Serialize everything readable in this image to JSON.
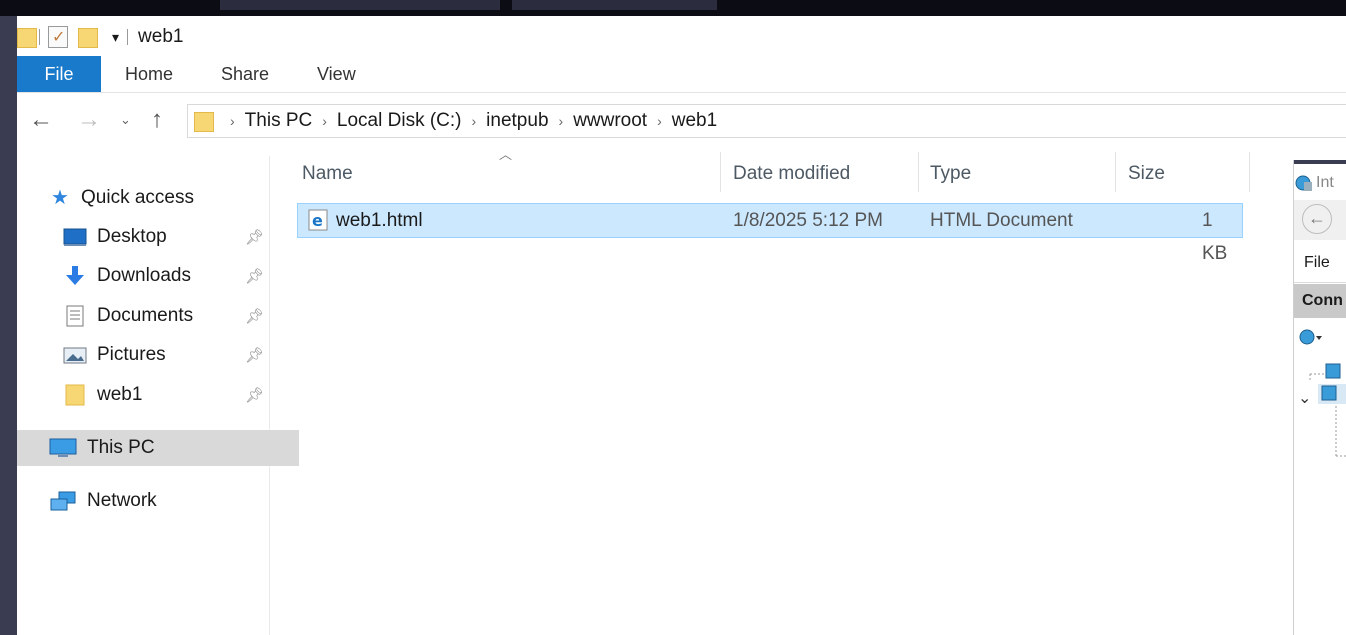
{
  "window": {
    "title": "web1"
  },
  "ribbon": {
    "tabs": [
      "File",
      "Home",
      "Share",
      "View"
    ]
  },
  "address": {
    "crumbs": [
      "This PC",
      "Local Disk (C:)",
      "inetpub",
      "wwwroot",
      "web1"
    ]
  },
  "nav": {
    "quick_access": "Quick access",
    "pinned": [
      "Desktop",
      "Downloads",
      "Documents",
      "Pictures",
      "web1"
    ],
    "this_pc": "This PC",
    "network": "Network"
  },
  "columns": {
    "name": "Name",
    "date": "Date modified",
    "type": "Type",
    "size": "Size"
  },
  "files": [
    {
      "name": "web1.html",
      "date": "1/8/2025 5:12 PM",
      "type": "HTML Document",
      "size": "1 KB"
    }
  ],
  "iis": {
    "title_partial": "Int",
    "menu_file": "File",
    "conn_partial": "Conn"
  },
  "colors": {
    "accent": "#1979ca",
    "selection": "#cce8ff",
    "folder": "#f7d774"
  },
  "icons": [
    "folder-icon",
    "checkmark-icon",
    "back-arrow-icon",
    "forward-arrow-icon",
    "up-arrow-icon",
    "star-icon",
    "desktop-icon",
    "download-icon",
    "documents-icon",
    "pictures-icon",
    "computer-icon",
    "network-icon",
    "ie-html-icon",
    "pin-icon"
  ]
}
